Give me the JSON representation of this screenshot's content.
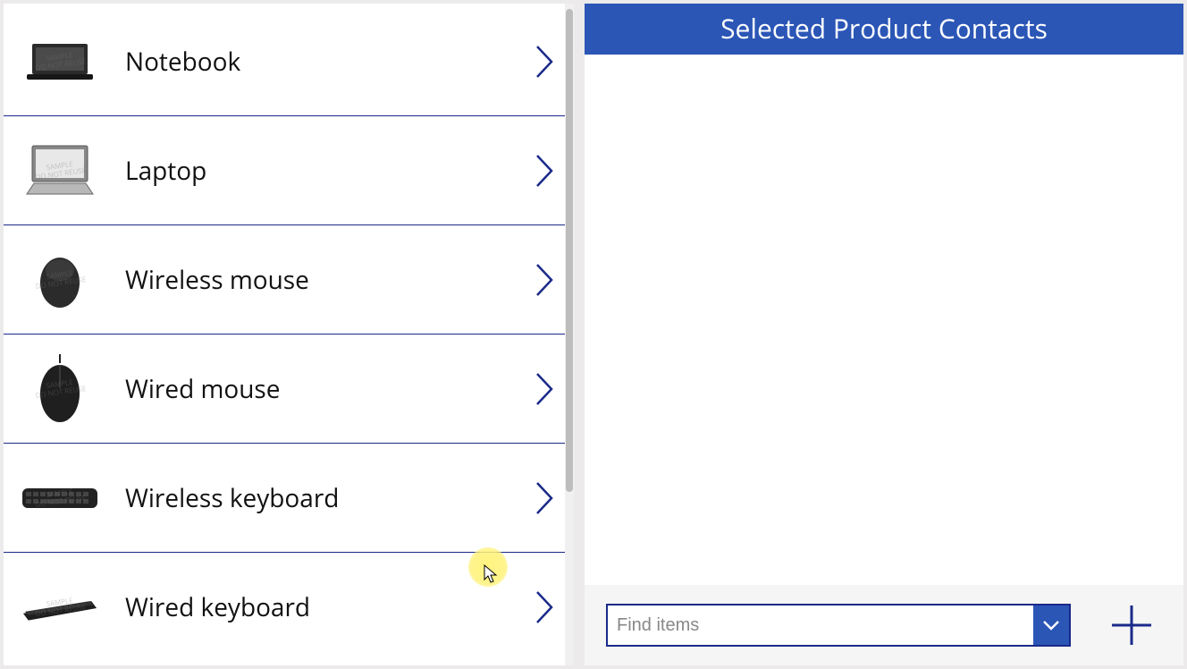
{
  "rightPanel": {
    "title": "Selected Product Contacts",
    "findPlaceholder": "Find items"
  },
  "products": [
    {
      "label": "Notebook",
      "icon": "laptop-closed"
    },
    {
      "label": "Laptop",
      "icon": "laptop-open"
    },
    {
      "label": "Wireless mouse",
      "icon": "mouse-wireless"
    },
    {
      "label": "Wired mouse",
      "icon": "mouse-wired"
    },
    {
      "label": "Wireless keyboard",
      "icon": "keyboard"
    },
    {
      "label": "Wired keyboard",
      "icon": "keyboard-angled"
    }
  ]
}
